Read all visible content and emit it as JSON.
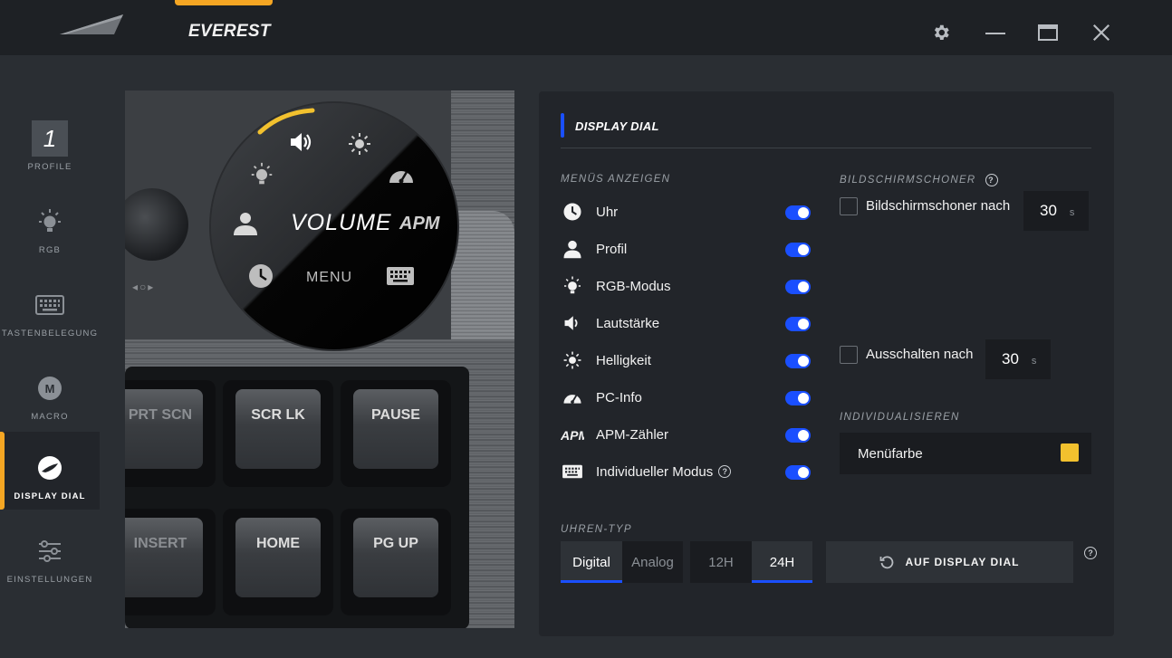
{
  "app": {
    "title": "EVEREST"
  },
  "sidebar": {
    "items": [
      {
        "label": "PROFILE",
        "value": "1",
        "icon": "profile-number-icon"
      },
      {
        "label": "RGB",
        "icon": "lightbulb-icon"
      },
      {
        "label": "TASTENBELEGUNG",
        "icon": "keyboard-icon"
      },
      {
        "label": "MACRO",
        "icon": "macro-icon"
      },
      {
        "label": "DISPLAY DIAL",
        "icon": "dial-icon",
        "active": true
      },
      {
        "label": "EINSTELLUNGEN",
        "icon": "sliders-icon"
      }
    ]
  },
  "keyboard": {
    "dial": {
      "center_label": "VOLUME",
      "apm_label": "APM",
      "menu_label": "MENU"
    },
    "keys": [
      "PRT SCN",
      "SCR LK",
      "PAUSE",
      "INSERT",
      "HOME",
      "PG UP"
    ]
  },
  "panel": {
    "title": "DISPLAY DIAL",
    "menus_section": "MENÜS ANZEIGEN",
    "menus": [
      {
        "label": "Uhr",
        "icon": "clock-icon",
        "enabled": true
      },
      {
        "label": "Profil",
        "icon": "user-icon",
        "enabled": true
      },
      {
        "label": "RGB-Modus",
        "icon": "lightbulb-icon",
        "enabled": true
      },
      {
        "label": "Lautstärke",
        "icon": "speaker-icon",
        "enabled": true
      },
      {
        "label": "Helligkeit",
        "icon": "sun-icon",
        "enabled": true
      },
      {
        "label": "PC-Info",
        "icon": "gauge-icon",
        "enabled": true
      },
      {
        "label": "APM-Zähler",
        "icon": "apm-icon",
        "enabled": true
      },
      {
        "label": "Individueller Modus",
        "icon": "keyboard-icon",
        "enabled": true,
        "info": true
      }
    ],
    "screensaver": {
      "section": "BILDSCHIRMSCHONER",
      "saver_label": "Bildschirmschoner nach",
      "saver_value": "30",
      "off_label": "Ausschalten nach",
      "off_value": "30",
      "unit": "s"
    },
    "customize": {
      "section": "INDIVIDUALISIEREN",
      "menu_color_label": "Menüfarbe",
      "menu_color": "#f2c12e"
    },
    "clock_type": {
      "section": "UHREN-TYP",
      "style_options": [
        "Digital",
        "Analog"
      ],
      "style_selected": "Digital",
      "format_options": [
        "12H",
        "24H"
      ],
      "format_selected": "24H"
    },
    "apply_button": "AUF DISPLAY DIAL"
  },
  "colors": {
    "accent_orange": "#f5a623",
    "accent_blue": "#1a4fff"
  }
}
